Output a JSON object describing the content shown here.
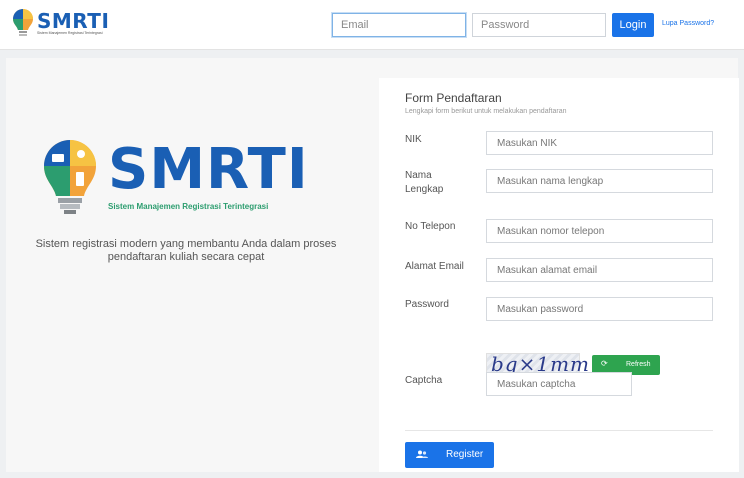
{
  "header": {
    "brand": "SMRTI",
    "tagline": "Sistem Manajemen Registrasi Terintegrasi",
    "email_placeholder": "Email",
    "password_placeholder": "Password",
    "login_label": "Login",
    "forgot_label": "Lupa Password?"
  },
  "hero": {
    "brand": "SMRTI",
    "subtitle": "Sistem Manajemen Registrasi Terintegrasi",
    "description": "Sistem registrasi modern yang membantu Anda dalam proses pendaftaran kuliah secara cepat"
  },
  "form": {
    "title": "Form Pendaftaran",
    "subtitle": "Lengkapi form berikut untuk melakukan pendaftaran",
    "fields": [
      {
        "label": "NIK",
        "placeholder": "Masukan NIK"
      },
      {
        "label": "Nama Lengkap",
        "placeholder": "Masukan nama lengkap"
      },
      {
        "label": "No Telepon",
        "placeholder": "Masukan nomor telepon"
      },
      {
        "label": "Alamat Email",
        "placeholder": "Masukan alamat email"
      },
      {
        "label": "Password",
        "placeholder": "Masukan password"
      }
    ],
    "captcha_text": "bq×1mm",
    "refresh_label": "Refresh",
    "captcha_label": "Captcha",
    "captcha_placeholder": "Masukan captcha",
    "register_label": "Register"
  },
  "colors": {
    "brand_blue": "#1a5fb4",
    "accent_blue": "#1a73e8",
    "success_green": "#2ea44f"
  },
  "icons": [
    "bulb-logo-icon",
    "refresh-icon",
    "register-users-icon"
  ]
}
